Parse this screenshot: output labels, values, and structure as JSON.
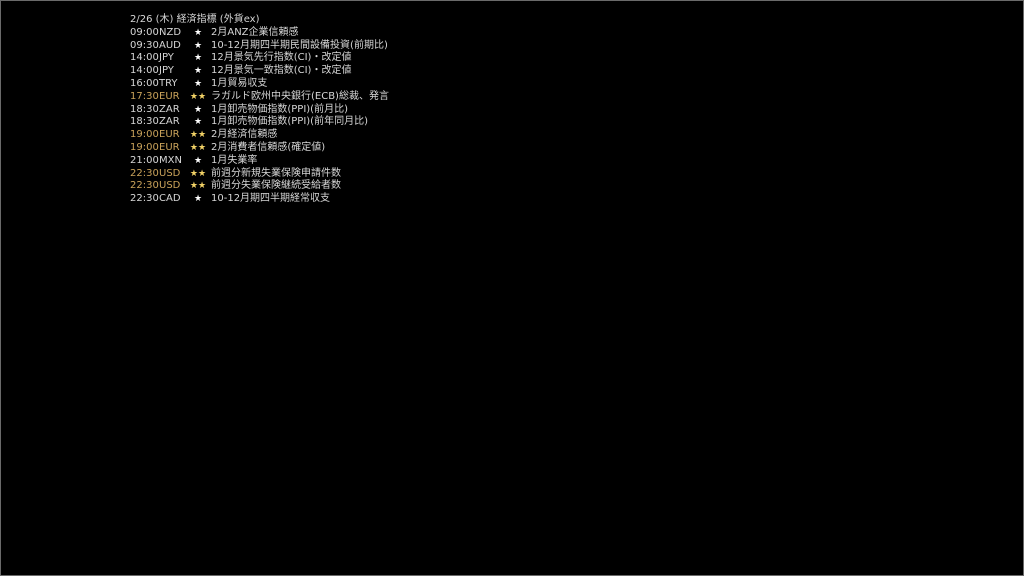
{
  "calendar": {
    "title": "2/26 (木) 経済指標 (外貨ex)",
    "highlight_color": "#c9a25a",
    "events": [
      {
        "time": "09:00",
        "currency": "NZD",
        "stars": "★",
        "name": "2月ANZ企業信頼感",
        "highlighted": false
      },
      {
        "time": "09:30",
        "currency": "AUD",
        "stars": "★",
        "name": "10-12月期四半期民間設備投資(前期比)",
        "highlighted": false
      },
      {
        "time": "14:00",
        "currency": "JPY",
        "stars": "★",
        "name": "12月景気先行指数(CI)・改定値",
        "highlighted": false
      },
      {
        "time": "14:00",
        "currency": "JPY",
        "stars": "★",
        "name": "12月景気一致指数(CI)・改定値",
        "highlighted": false
      },
      {
        "time": "16:00",
        "currency": "TRY",
        "stars": "★",
        "name": "1月貿易収支",
        "highlighted": false
      },
      {
        "time": "17:30",
        "currency": "EUR",
        "stars": "★★",
        "name": "ラガルド欧州中央銀行(ECB)総裁、発言",
        "highlighted": true
      },
      {
        "time": "18:30",
        "currency": "ZAR",
        "stars": "★",
        "name": "1月卸売物価指数(PPI)(前月比)",
        "highlighted": false
      },
      {
        "time": "18:30",
        "currency": "ZAR",
        "stars": "★",
        "name": "1月卸売物価指数(PPI)(前年同月比)",
        "highlighted": false
      },
      {
        "time": "19:00",
        "currency": "EUR",
        "stars": "★★",
        "name": "2月経済信頼感",
        "highlighted": true
      },
      {
        "time": "19:00",
        "currency": "EUR",
        "stars": "★★",
        "name": "2月消費者信頼感(確定値)",
        "highlighted": true
      },
      {
        "time": "21:00",
        "currency": "MXN",
        "stars": "★",
        "name": "1月失業率",
        "highlighted": false
      },
      {
        "time": "22:30",
        "currency": "USD",
        "stars": "★★",
        "name": "前週分新規失業保険申請件数",
        "highlighted": true
      },
      {
        "time": "22:30",
        "currency": "USD",
        "stars": "★★",
        "name": "前週分失業保険継続受給者数",
        "highlighted": true
      },
      {
        "time": "22:30",
        "currency": "CAD",
        "stars": "★",
        "name": "10-12月期四半期経常収支",
        "highlighted": false
      }
    ]
  }
}
